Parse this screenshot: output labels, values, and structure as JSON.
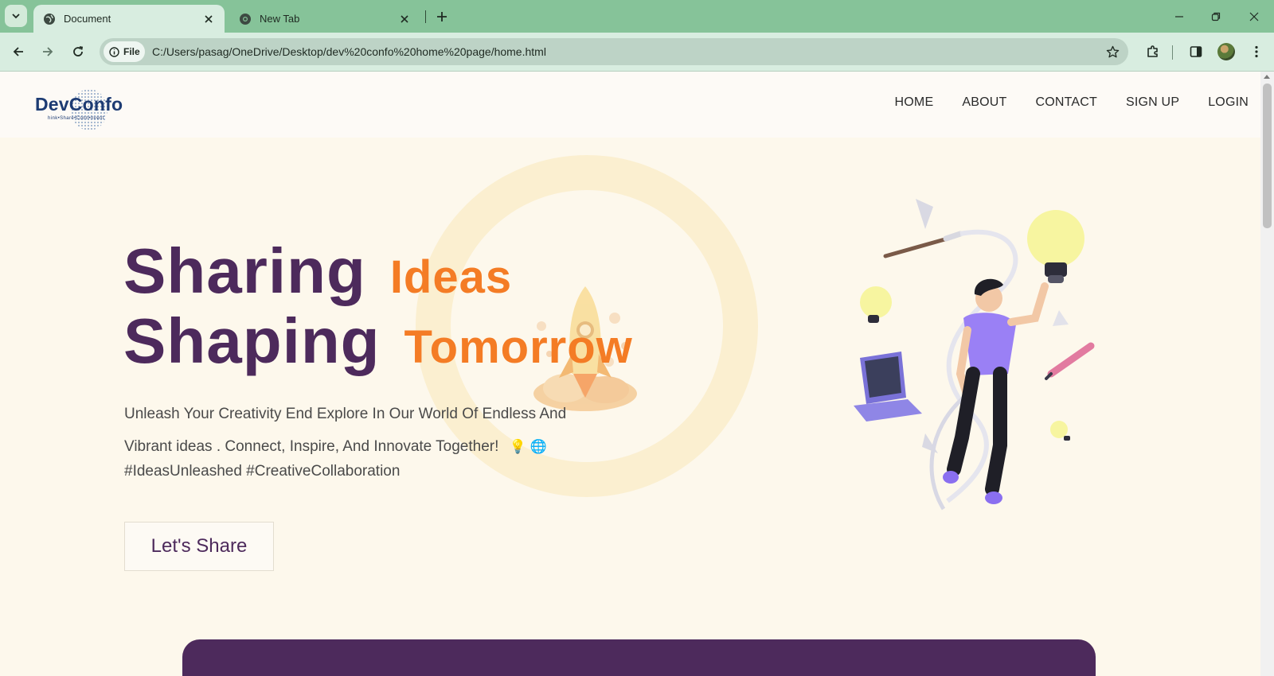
{
  "browser": {
    "tabs": [
      {
        "title": "Document",
        "active": true,
        "icon": "globe-icon"
      },
      {
        "title": "New Tab",
        "active": false,
        "icon": "chrome-icon"
      }
    ],
    "omnibox": {
      "chip_label": "File",
      "url": "C:/Users/pasag/OneDrive/Desktop/dev%20confo%20home%20page/home.html"
    }
  },
  "site": {
    "logo": {
      "name": "DevConfo",
      "tagline": "hink•Share•Conn•nvent"
    },
    "nav": [
      "HOME",
      "ABOUT",
      "CONTACT",
      "SIGN UP",
      "LOGIN"
    ],
    "hero": {
      "line1_dark": "Sharing",
      "line1_accent": "Ideas",
      "line2_dark": "Shaping",
      "line2_accent": "Tomorrow",
      "sub_line1": "Unleash Your Creativity End Explore In Our World Of Endless And",
      "sub_line2": "Vibrant ideas . Connect, Inspire, And Innovate Together!",
      "sub_emoji": "💡 🌐",
      "hashtags": "#IdeasUnleashed #CreativeCollaboration",
      "cta": "Let's Share"
    }
  },
  "colors": {
    "tabstrip": "#86c399",
    "toolbar": "#d8ede0",
    "primary_purple": "#4d2a5c",
    "accent_orange": "#f47c25",
    "page_bg": "#fdf8ec",
    "logo_blue": "#1d3b73"
  }
}
